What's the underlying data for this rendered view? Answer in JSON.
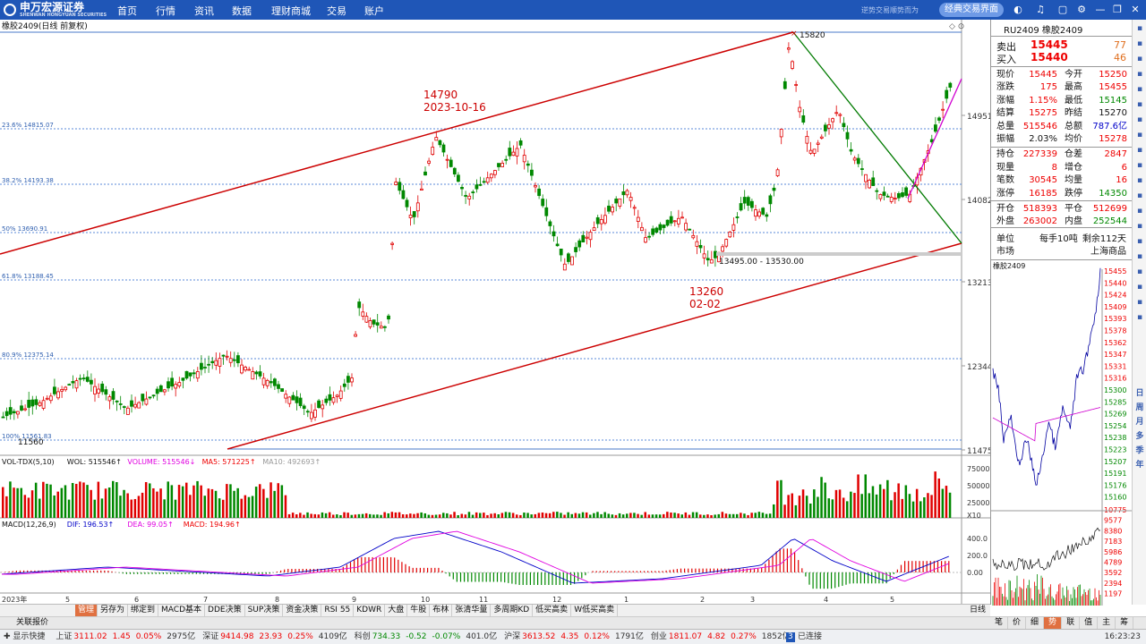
{
  "topbar": {
    "logo_text": "申万宏源证券",
    "logo_sub": "SHENWAN HONGYUAN SECURITIES",
    "nav": [
      "首页",
      "行情",
      "资讯",
      "数据",
      "理财商城",
      "交易",
      "账户"
    ],
    "slogan": "逆势交易顺势而为",
    "classic_button": "经典交易界面",
    "icons": [
      "skin-icon",
      "headset-icon",
      "lock-icon",
      "gear-icon",
      "minimize-icon",
      "restore-icon",
      "close-icon"
    ]
  },
  "chart": {
    "title": "橡胶2409(日线 前复权)",
    "y_labels": [
      "14951",
      "14082",
      "13213",
      "12344",
      "11475"
    ],
    "fib_labels": [
      "23.6% 14815.07",
      "38.2% 14193.38",
      "50% 13690.91",
      "61.8% 13188.45",
      "80.9% 12375.14",
      "100% 11561.83"
    ],
    "annotations": {
      "high_mark": "15820",
      "low_mark": "11560",
      "peak1_price": "14790",
      "peak1_date": "2023-10-16",
      "trough_price": "13260",
      "trough_date": "02-02",
      "zone_label": "13495.00 - 13530.00"
    },
    "x_labels": [
      "2023年",
      "5",
      "6",
      "7",
      "8",
      "9",
      "10",
      "11",
      "12",
      "1",
      "2",
      "3",
      "4",
      "5"
    ]
  },
  "volume": {
    "label_parts": [
      {
        "text": "VOL-TDX(5,10) ",
        "color": "#111"
      },
      {
        "text": "WOL: 515546↑ ",
        "color": "#111"
      },
      {
        "text": "VOLUME: 515546↓ ",
        "color": "#e000e0"
      },
      {
        "text": "MA5: 571225↑ ",
        "color": "#e00"
      },
      {
        "text": "MA10: 492693↑",
        "color": "#999"
      }
    ],
    "y_labels": [
      "75000",
      "50000",
      "25000",
      "X10"
    ]
  },
  "macd": {
    "label_parts": [
      {
        "text": "MACD(12,26,9) ",
        "color": "#111"
      },
      {
        "text": "DIF: 196.53↑ ",
        "color": "#0000c8"
      },
      {
        "text": "DEA: 99.05↑ ",
        "color": "#e000e0"
      },
      {
        "text": "MACD: 194.96↑",
        "color": "#e00"
      }
    ],
    "y_labels": [
      "400.0",
      "200.0",
      "0.00"
    ]
  },
  "quote": {
    "code": "RU2409 橡胶2409",
    "sell": {
      "label": "卖出",
      "price": "15445",
      "vol": "77"
    },
    "buy": {
      "label": "买入",
      "price": "15440",
      "vol": "46"
    },
    "rows": [
      [
        "现价",
        "15445",
        "red",
        "今开",
        "15250",
        "red"
      ],
      [
        "涨跌",
        "175",
        "red",
        "最高",
        "15455",
        "red"
      ],
      [
        "涨幅",
        "1.15%",
        "red",
        "最低",
        "15145",
        "grn"
      ],
      [
        "结算",
        "15275",
        "red",
        "昨结",
        "15270",
        "blk"
      ],
      [
        "总量",
        "515546",
        "red",
        "总额",
        "787.6亿",
        "blu"
      ],
      [
        "振幅",
        "2.03%",
        "blk",
        "均价",
        "15278",
        "red"
      ],
      [
        "持仓",
        "227339",
        "red",
        "仓差",
        "2847",
        "red"
      ],
      [
        "现量",
        "8",
        "red",
        "增仓",
        "6",
        "red"
      ],
      [
        "笔数",
        "30545",
        "red",
        "均量",
        "16",
        "red"
      ],
      [
        "涨停",
        "16185",
        "red",
        "跌停",
        "14350",
        "grn"
      ],
      [
        "开仓",
        "518393",
        "red",
        "平仓",
        "512699",
        "red"
      ],
      [
        "外盘",
        "263002",
        "red",
        "内盘",
        "252544",
        "grn"
      ]
    ],
    "unit_label": "单位",
    "unit_value": "每手10吨",
    "remain": "剩余112天",
    "market_label": "市场",
    "market_value": "上海商品"
  },
  "tick": {
    "title": "橡胶2409",
    "price_labels": [
      "15455",
      "15440",
      "15424",
      "15409",
      "15393",
      "15378",
      "15362",
      "15347",
      "15331",
      "15316",
      "15300",
      "15285",
      "15269",
      "15254",
      "15238",
      "15223",
      "15207",
      "15191",
      "15176",
      "15160"
    ],
    "vol_labels": [
      "10775",
      "9577",
      "8380",
      "7183",
      "5986",
      "4789",
      "3592",
      "2394",
      "1197"
    ]
  },
  "tabs": [
    "管理",
    "另存为",
    "绑定到",
    "MACD基本",
    "DDE决策",
    "SUP决策",
    "资金决策",
    "RSI 55",
    "KDWR",
    "大盘",
    "牛股",
    "布林",
    "张清华量",
    "多周期KD",
    "低买高卖",
    "W低买高卖"
  ],
  "tabs_active": 0,
  "period_label": "日线",
  "gj_label": "关联报价",
  "right_tabs": [
    "笔",
    "价",
    "细",
    "势",
    "联",
    "值",
    "主",
    "筹"
  ],
  "right_tabs_active": 3,
  "rightbar_icons": [
    "日",
    "周",
    "月",
    "多",
    "季",
    "年"
  ],
  "status": {
    "prefix": "显示快捷",
    "indexes": [
      {
        "name": "上证",
        "v": "3111.02",
        "c": "1.45",
        "p": "0.05%",
        "amt": "2975亿"
      },
      {
        "name": "深证",
        "v": "9414.98",
        "c": "23.93",
        "p": "0.25%",
        "amt": "4109亿"
      },
      {
        "name": "科创",
        "v": "734.33",
        "c": "-0.52",
        "p": "-0.07%",
        "amt": "401.0亿"
      },
      {
        "name": "沪深",
        "v": "3613.52",
        "c": "4.35",
        "p": "0.12%",
        "amt": "1791亿"
      },
      {
        "name": "创业",
        "v": "1811.07",
        "c": "4.82",
        "p": "0.27%",
        "amt": "1852亿"
      }
    ],
    "conn_num": "3",
    "conn": "已连接",
    "time": "16:23:23"
  },
  "colors": {
    "brand": "#1f56b7",
    "up": "#e00000",
    "down": "#008800",
    "channel": "#cc0000",
    "trend_down": "#007a00",
    "trend_up": "#d000d0"
  }
}
